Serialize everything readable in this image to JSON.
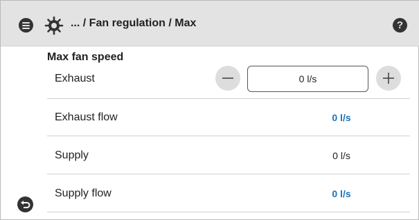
{
  "header": {
    "breadcrumb": "... / Fan regulation / Max",
    "menu_icon": "menu-icon",
    "settings_icon": "gear-icon",
    "help_icon": "help-icon",
    "help_glyph": "?"
  },
  "section": {
    "title": "Max fan speed"
  },
  "exhaust": {
    "label": "Exhaust",
    "value": "0 l/s",
    "decrement_icon": "minus-icon",
    "increment_icon": "plus-icon"
  },
  "rows": [
    {
      "label": "Exhaust flow",
      "value": "0 l/s",
      "style": "flow"
    },
    {
      "label": "Supply",
      "value": "0 l/s",
      "style": "plain"
    },
    {
      "label": "Supply flow",
      "value": "0 l/s",
      "style": "flow"
    }
  ],
  "footer": {
    "back_icon": "back-icon"
  },
  "colors": {
    "header_bg": "#e3e3e3",
    "flow_value": "#1b73b8",
    "icon_dark": "#333333"
  }
}
